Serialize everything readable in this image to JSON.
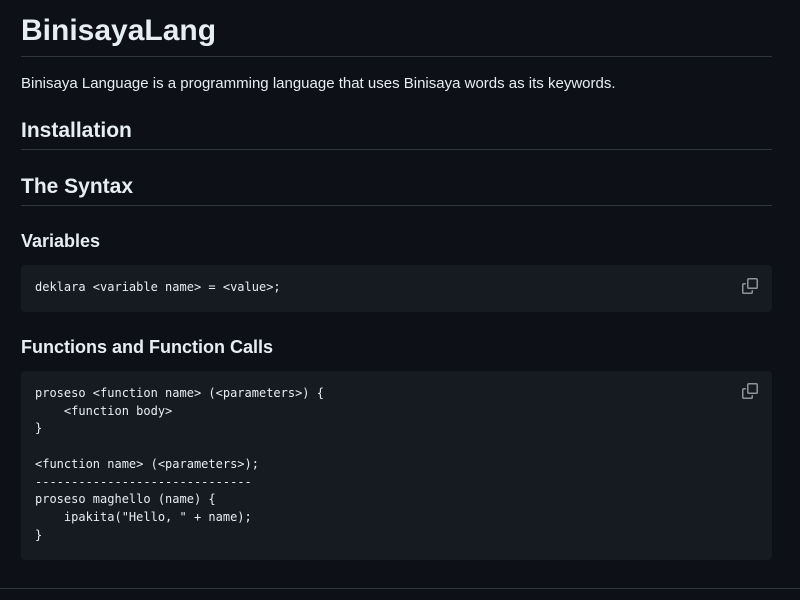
{
  "title": "BinisayaLang",
  "intro": "Binisaya Language is a programming language that uses Binisaya words as its keywords.",
  "sections": {
    "installation": "Installation",
    "syntax": "The Syntax",
    "variables": "Variables",
    "functions": "Functions and Function Calls"
  },
  "code": {
    "variables": "deklara <variable name> = <value>;",
    "functions": "proseso <function name> (<parameters>) {\n    <function body>\n}\n\n<function name> (<parameters>);\n------------------------------\nproseso maghello (name) {\n    ipakita(\"Hello, \" + name);\n}"
  },
  "icons": {
    "copy": "copy-icon"
  },
  "colors": {
    "background": "#0d1117",
    "code_background": "#161b22",
    "text": "#e6edf3",
    "rule": "#30363d",
    "icon": "#8b949e"
  }
}
